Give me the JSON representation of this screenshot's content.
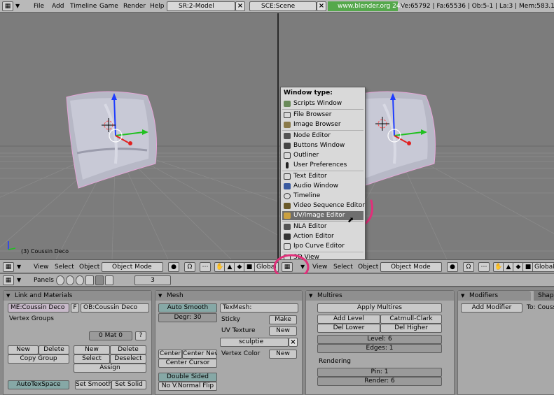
{
  "topbar": {
    "menu": [
      "File",
      "Add",
      "Timeline",
      "Game",
      "Render",
      "Help"
    ],
    "screen_field": "SR:2-Model",
    "scene_field": "SCE:Scene",
    "link": "www.blender.org 249",
    "stats": "Ve:65792 | Fa:65536 | Ob:5-1 | La:3 | Mem:583.13M ("
  },
  "viewport_left": {
    "object_label": "(3) Coussin Deco"
  },
  "header_left": {
    "menu": [
      "View",
      "Select",
      "Object"
    ],
    "mode": "Object Mode",
    "orientation": "Global"
  },
  "header_right": {
    "menu": [
      "View",
      "Select",
      "Object"
    ],
    "mode": "Object Mode",
    "orientation": "Global"
  },
  "window_type_menu": {
    "title": "Window type:",
    "items": [
      "Scripts Window",
      "File Browser",
      "Image Browser",
      "Node Editor",
      "Buttons Window",
      "Outliner",
      "User Preferences",
      "Text Editor",
      "Audio Window",
      "Timeline",
      "Video Sequence Editor",
      "UV/Image Editor",
      "NLA Editor",
      "Action Editor",
      "Ipo Curve Editor",
      "3D View"
    ],
    "selected": "UV/Image Editor"
  },
  "panels_header": {
    "label": "Panels",
    "number": "3"
  },
  "link_materials": {
    "title": "Link and Materials",
    "mesh_field": "ME:Coussin Deco",
    "f_label": "F",
    "ob_field": "OB:Coussin Deco",
    "vertex_groups": "Vertex Groups",
    "mat_field": "0 Mat 0",
    "question": "?",
    "new": "New",
    "delete": "Delete",
    "copy_group": "Copy Group",
    "new2": "New",
    "delete2": "Delete",
    "select": "Select",
    "deselect": "Deselect",
    "assign": "Assign",
    "autotexspace": "AutoTexSpace",
    "set_smooth": "Set Smooth",
    "set_solid": "Set Solid"
  },
  "mesh": {
    "title": "Mesh",
    "auto_smooth": "Auto Smooth",
    "degr": "Degr: 30",
    "texmesh": "TexMesh:",
    "sticky": "Sticky",
    "make": "Make",
    "uv_texture": "UV Texture",
    "new": "New",
    "sculptie": "sculptie",
    "vertex_color": "Vertex Color",
    "new2": "New",
    "center": "Center",
    "center_new": "Center New",
    "center_cursor": "Center Cursor",
    "double_sided": "Double Sided",
    "no_vnormal_flip": "No V.Normal Flip"
  },
  "multires": {
    "title": "Multires",
    "apply": "Apply Multires",
    "add_level": "Add Level",
    "catmull": "Catmull-Clark",
    "del_lower": "Del Lower",
    "del_higher": "Del Higher",
    "level": "Level: 6",
    "edges": "Edges: 1",
    "rendering": "Rendering",
    "pin": "Pin: 1",
    "render": "Render: 6"
  },
  "modifiers": {
    "tab1": "Modifiers",
    "tab2": "Shap",
    "add_modifier": "Add Modifier",
    "to": "To: Couss"
  },
  "colors": {
    "accent_green": "#55a84c",
    "highlight_pink": "#e0307a",
    "menu_selected": "#6e6e6e"
  }
}
